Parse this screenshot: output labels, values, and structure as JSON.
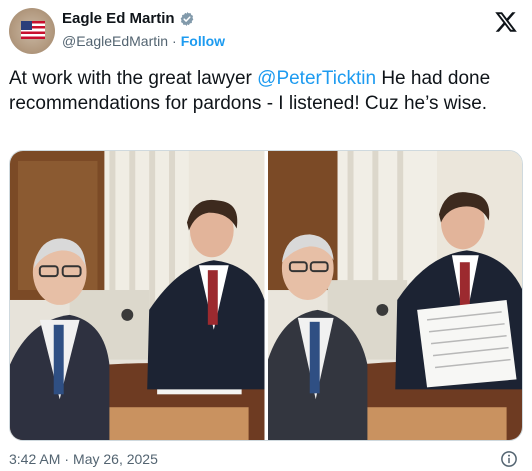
{
  "author": {
    "display_name": "Eagle Ed Martin",
    "handle": "@EagleEdMartin",
    "separator": "·",
    "follow_label": "Follow"
  },
  "tweet": {
    "text_before": "At work with the great lawyer ",
    "mention": "@PeterTicktin",
    "text_after": "  He had done recommendations for pardons - I listened! Cuz he’s wise."
  },
  "footer": {
    "time": "3:42 AM",
    "separator": "·",
    "date": "May 26, 2025"
  },
  "icons": {
    "verified": "verified-badge-icon",
    "platform": "x-logo-icon",
    "info": "info-icon"
  },
  "colors": {
    "link": "#1d9bf0",
    "text": "#0f1419",
    "muted": "#536471"
  }
}
